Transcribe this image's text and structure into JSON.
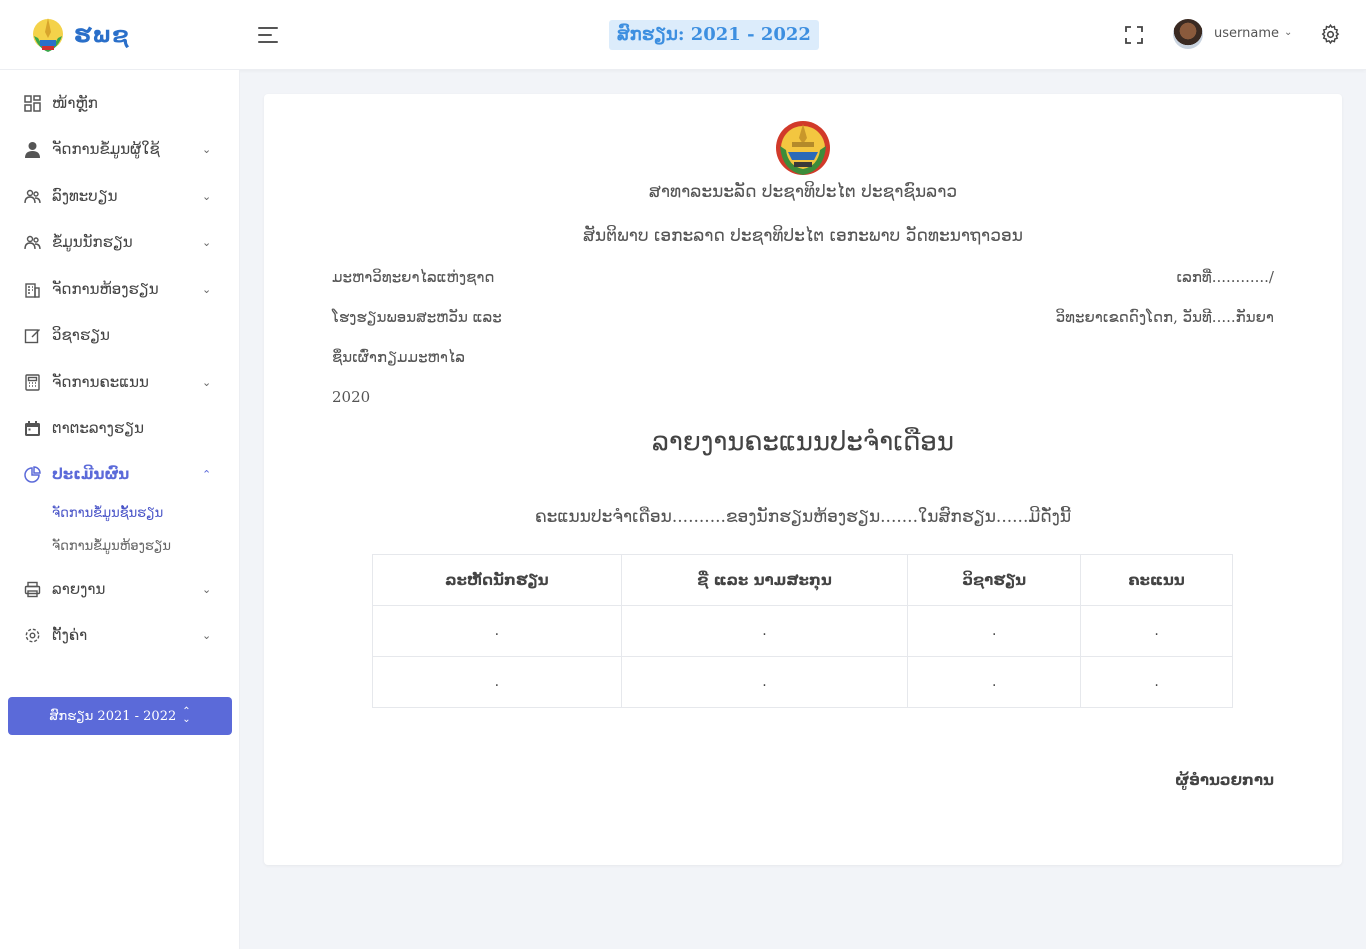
{
  "header": {
    "logo_text": "ຮພຊ",
    "academic_year": "ສົກຮຽນ: 2021 - 2022",
    "username": "username"
  },
  "sidebar": {
    "items": [
      {
        "label": "ໜ້າຫຼັກ",
        "icon": "dashboard-icon",
        "has_children": false
      },
      {
        "label": "ຈັດການຂໍ້ມູນຜູ້ໃຊ້",
        "icon": "user-icon",
        "has_children": true
      },
      {
        "label": "ລົງທະບຽນ",
        "icon": "users-icon",
        "has_children": true
      },
      {
        "label": "ຂໍ້ມູນນັກຮຽນ",
        "icon": "students-icon",
        "has_children": true
      },
      {
        "label": "ຈັດການຫ້ອງຮຽນ",
        "icon": "building-icon",
        "has_children": true
      },
      {
        "label": "ວິຊາຮຽນ",
        "icon": "edit-icon",
        "has_children": false
      },
      {
        "label": "ຈັດການຄະແນນ",
        "icon": "calculator-icon",
        "has_children": true
      },
      {
        "label": "ຕາຕະລາງຮຽນ",
        "icon": "calendar-icon",
        "has_children": false
      },
      {
        "label": "ປະເມີນຜົນ",
        "icon": "pie-chart-icon",
        "has_children": true,
        "expanded": true
      },
      {
        "label": "ລາຍງານ",
        "icon": "printer-icon",
        "has_children": true
      },
      {
        "label": "ຕັ້ງຄ່າ",
        "icon": "gear-icon",
        "has_children": true
      }
    ],
    "sub_items": [
      {
        "label": "ຈັດການຂໍ້ມູນຊັ້ນຮຽນ",
        "active": true
      },
      {
        "label": "ຈັດການຂໍ້ມູນຫ້ອງຮຽນ",
        "active": false
      }
    ],
    "year_button": "ສົກຮຽນ 2021 - 2022"
  },
  "document": {
    "republic": "ສາທາລະນະລັດ ປະຊາທິປະໄຕ ປະຊາຊົນລາວ",
    "motto": "ສັນຕິພາບ ເອກະລາດ ປະຊາທິປະໄຕ ເອກະພາບ ວັດທະນາຖາວອນ",
    "left_lines": [
      "ມະຫາວິທະຍາໄລແຫ່ງຊາດ",
      "ໂຮງຮຽນພອນສະຫວັນ ແລະ",
      "ຊຶ່ນເຜົ່າກຽມມະຫາໄລ",
      "2020"
    ],
    "right_lines": [
      "ເລກທີ່............/",
      "ວິທະຍາເຂດດົງໂດກ, ວັນທີ.....ກັນຍາ"
    ],
    "title": "ລາຍງານຄະແນນປະຈຳເດືອນ",
    "subtitle": "ຄະແນນປະຈຳເດືອນ..........ຂອງນັກຮຽນຫ້ອງຮຽນ.......ໃນສົກຮຽນ......ມີດັ່ງນີ້",
    "table": {
      "headers": [
        "ລະຫັດນັກຮຽນ",
        "ຊື່ ແລະ ນາມສະກຸນ",
        "ວິຊາຮຽນ",
        "ຄະແນນ"
      ],
      "rows": [
        [
          ".",
          ".",
          ".",
          "."
        ],
        [
          ".",
          ".",
          ".",
          "."
        ]
      ]
    },
    "signer": "ຜູ້ອຳນວຍການ"
  }
}
